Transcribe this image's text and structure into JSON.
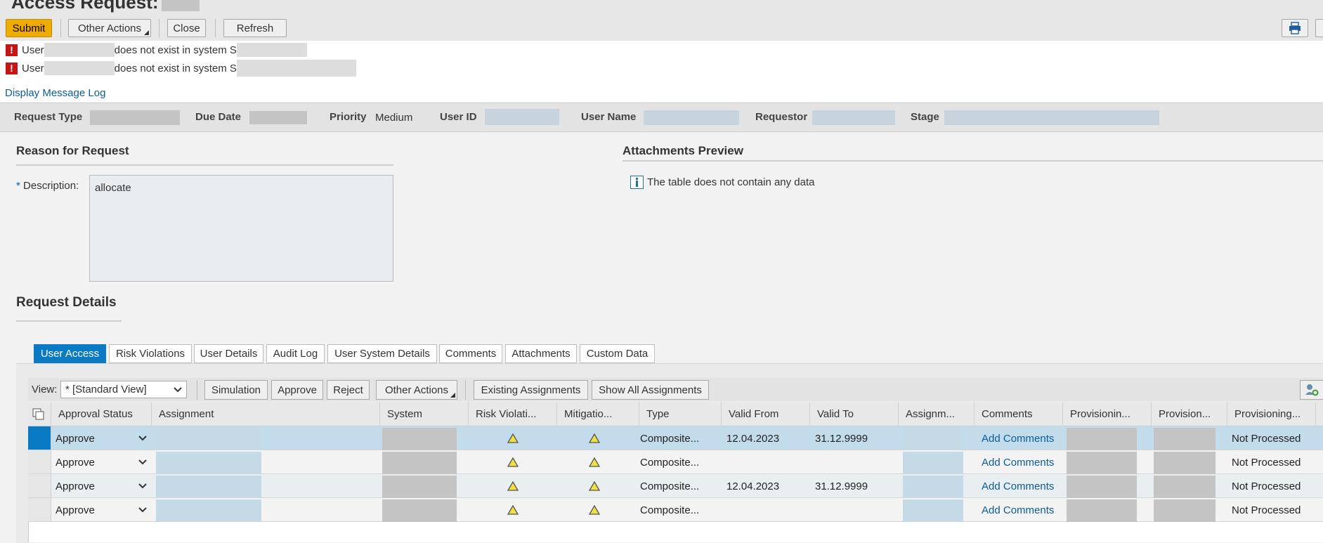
{
  "header": {
    "title": "Access Request:",
    "buttons": {
      "submit": "Submit",
      "other_actions": "Other Actions",
      "close": "Close",
      "refresh": "Refresh"
    }
  },
  "messages": [
    {
      "pre": "User",
      "post": "does not exist in system S"
    },
    {
      "pre": "User",
      "post": "does not exist in system S"
    }
  ],
  "display_message_log": "Display Message Log",
  "info_bar": {
    "request_type_label": "Request Type",
    "due_date_label": "Due Date",
    "priority_label": "Priority",
    "priority_value": "Medium",
    "user_id_label": "User ID",
    "user_name_label": "User Name",
    "requestor_label": "Requestor",
    "stage_label": "Stage"
  },
  "reason": {
    "title": "Reason for Request",
    "required_mark": "*",
    "description_label": "Description:",
    "description_value": "allocate"
  },
  "attachments": {
    "title": "Attachments Preview",
    "empty_text": "The table does not contain any data"
  },
  "request_details": {
    "title": "Request Details",
    "tabs": [
      "User Access",
      "Risk Violations",
      "User Details",
      "Audit Log",
      "User System Details",
      "Comments",
      "Attachments",
      "Custom Data"
    ],
    "toolbar": {
      "view_label": "View:",
      "view_value": "* [Standard View]",
      "simulation": "Simulation",
      "approve": "Approve",
      "reject": "Reject",
      "other_actions": "Other Actions",
      "existing_assignments": "Existing Assignments",
      "show_all_assignments": "Show All Assignments"
    },
    "columns": [
      "Approval Status",
      "Assignment",
      "System",
      "Risk Violati...",
      "Mitigatio...",
      "Type",
      "Valid From",
      "Valid To",
      "Assignm...",
      "Comments",
      "Provisionin...",
      "Provision...",
      "Provisioning..."
    ],
    "rows": [
      {
        "approval": "Approve",
        "type": "Composite...",
        "valid_from": "12.04.2023",
        "valid_to": "31.12.9999",
        "comments": "Add Comments",
        "provisioning": "Not Processed"
      },
      {
        "approval": "Approve",
        "type": "Composite...",
        "valid_from": "",
        "valid_to": "",
        "comments": "Add Comments",
        "provisioning": "Not Processed"
      },
      {
        "approval": "Approve",
        "type": "Composite...",
        "valid_from": "12.04.2023",
        "valid_to": "31.12.9999",
        "comments": "Add Comments",
        "provisioning": "Not Processed"
      },
      {
        "approval": "Approve",
        "type": "Composite...",
        "valid_from": "",
        "valid_to": "",
        "comments": "Add Comments",
        "provisioning": "Not Processed"
      }
    ]
  },
  "icons": [
    "error-icon",
    "info-icon",
    "print-icon",
    "warning-icon",
    "settings-icon",
    "column-select-icon",
    "chevron-down-icon"
  ],
  "colors": {
    "primary_button": "#f0ab00",
    "active_tab": "#0a7ac4",
    "link": "#0b5c9a",
    "error": "#c81414"
  }
}
